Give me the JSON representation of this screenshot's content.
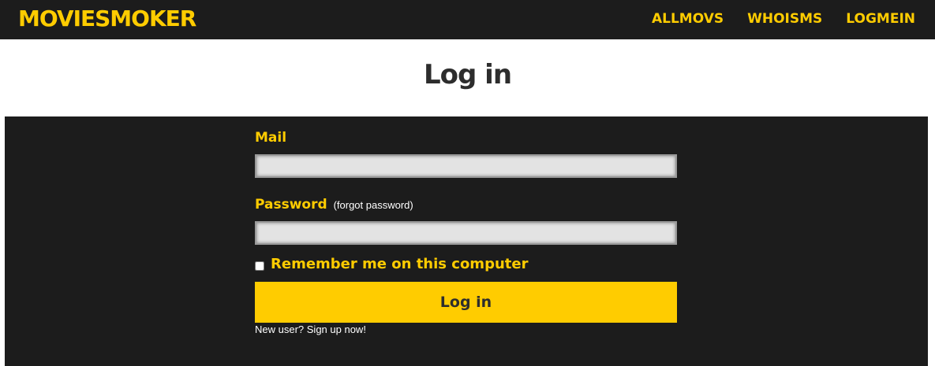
{
  "header": {
    "logo": "MOVIESMOKER",
    "nav": [
      {
        "label": "ALLMOVS"
      },
      {
        "label": "WHOISMS"
      },
      {
        "label": "LOGMEIN"
      }
    ]
  },
  "page": {
    "title": "Log in"
  },
  "form": {
    "mail_label": "Mail",
    "mail_value": "",
    "password_label": "Password",
    "forgot_link": "(forgot password)",
    "password_value": "",
    "remember_label": "Remember me on this computer",
    "remember_checked": false,
    "submit_label": "Log in",
    "new_user_text": "New user?",
    "signup_link": "Sign up now!"
  },
  "colors": {
    "accent": "#ffcc00",
    "dark": "#1c1c1c",
    "title": "#2d2d2d"
  }
}
